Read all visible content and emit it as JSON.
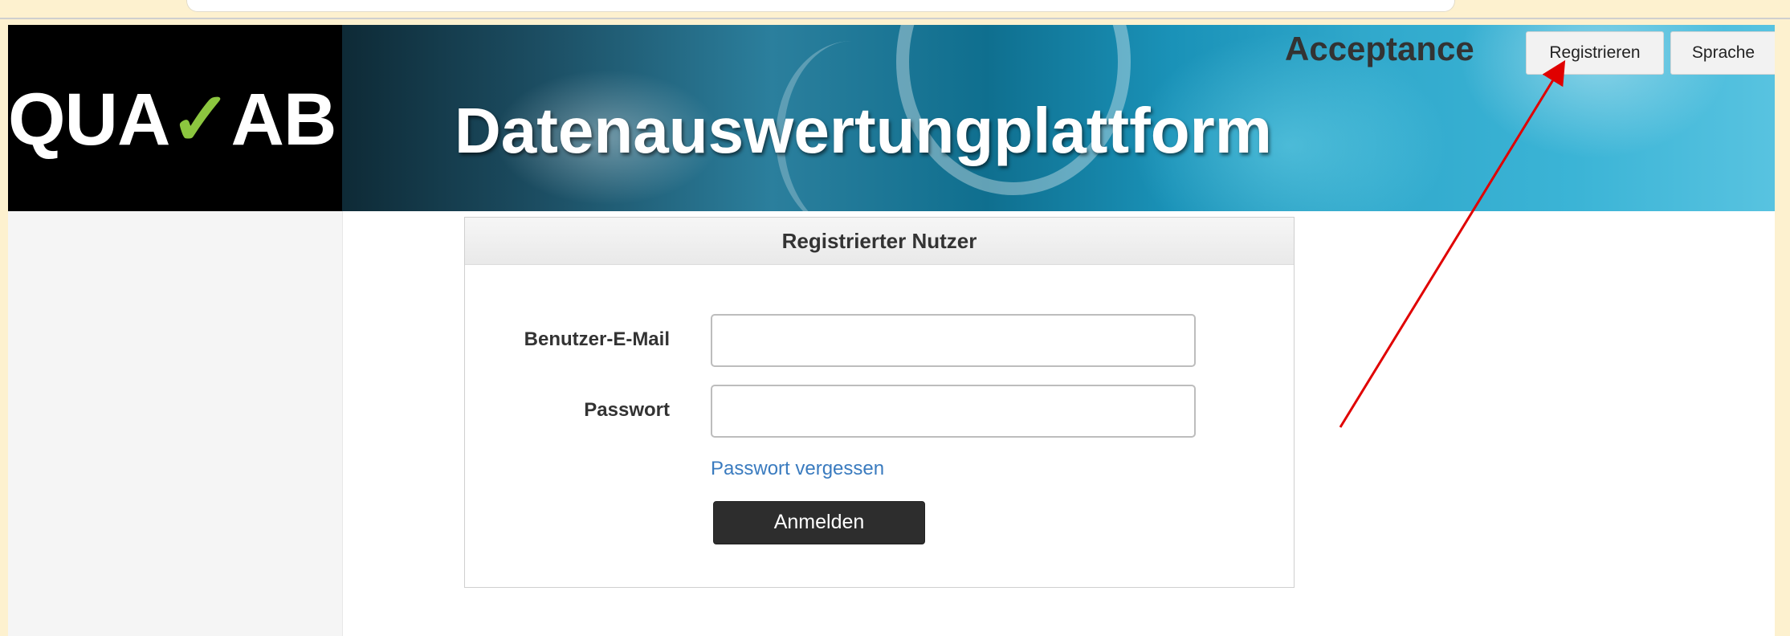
{
  "header": {
    "logo_text_left": "QUA",
    "logo_check": "✓",
    "logo_text_right": "AB",
    "banner_title": "Datenauswertungplattform",
    "environment": "Acceptance",
    "register_label": "Registrieren",
    "language_label": "Sprache"
  },
  "login": {
    "title": "Registrierter Nutzer",
    "email_label": "Benutzer-E-Mail",
    "email_value": "",
    "password_label": "Passwort",
    "password_value": "",
    "forgot_label": "Passwort vergessen",
    "submit_label": "Anmelden"
  },
  "colors": {
    "logo_check": "#8cc63f",
    "link": "#3a7bbf",
    "button_dark": "#2d2d2d",
    "annotation_arrow": "#e00000",
    "frame_background": "#fdf1cf"
  },
  "icons": {
    "annotation": "red-arrow-icon"
  }
}
